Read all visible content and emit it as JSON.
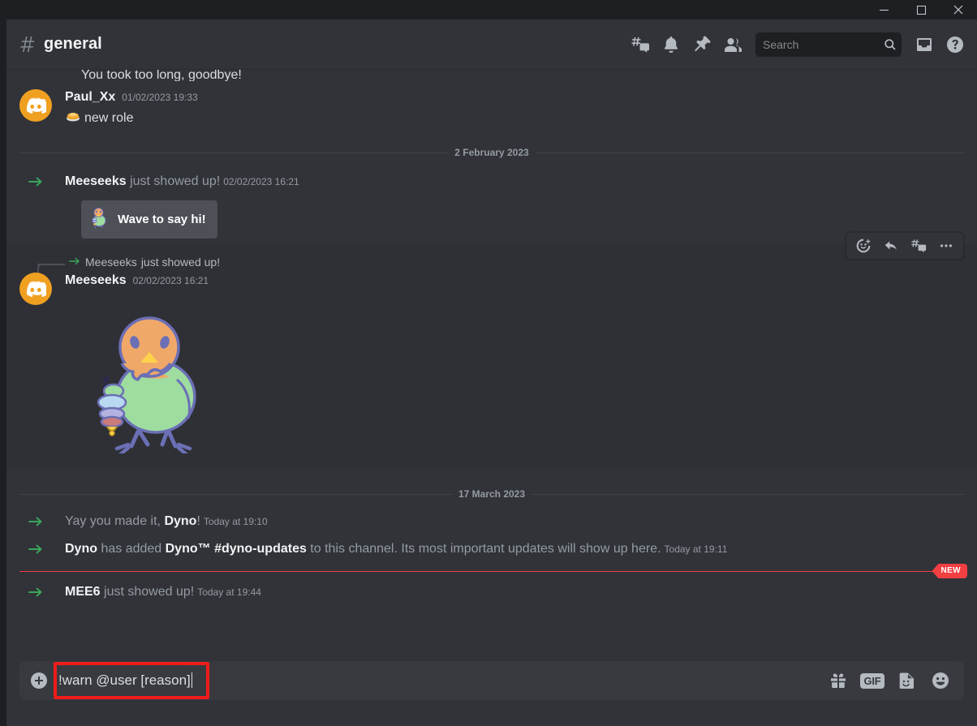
{
  "window": {
    "minimize_label": "Minimize",
    "maximize_label": "Maximize",
    "close_label": "Close"
  },
  "header": {
    "hash_icon": "hash-icon",
    "channel_name": "general",
    "icons": [
      {
        "name": "threads-icon",
        "label": "Threads"
      },
      {
        "name": "bell-icon",
        "label": "Notification Settings"
      },
      {
        "name": "pin-icon",
        "label": "Pinned Messages"
      },
      {
        "name": "members-icon",
        "label": "Member List"
      }
    ],
    "search": {
      "placeholder": "Search",
      "icon": "search-icon"
    },
    "right_icons": [
      {
        "name": "inbox-icon",
        "label": "Inbox"
      },
      {
        "name": "help-icon",
        "label": "Help"
      }
    ]
  },
  "chat": {
    "clipped_message": "You took too long, goodbye!",
    "messages": [
      {
        "type": "user",
        "author": "Paul_Xx",
        "timestamp": "01/02/2023 19:33",
        "emoji": "role-stack-emoji",
        "content": "new role"
      }
    ],
    "divider_1": "2 February 2023",
    "join_message": {
      "author": "Meeseeks",
      "text": " just showed up!",
      "timestamp": "02/02/2023 16:21",
      "wave_button_label": "Wave to say hi!",
      "wave_button_icon": "bird-mascot-icon"
    },
    "reply_message": {
      "reply_to_author": "Meeseeks",
      "reply_to_text": " just showed up!",
      "author": "Meeseeks",
      "timestamp": "02/02/2023 16:21",
      "attachment_alt": "bird-mascot-image"
    },
    "hover_toolbar": [
      {
        "name": "add-reaction-icon",
        "label": "Add Reaction"
      },
      {
        "name": "reply-icon",
        "label": "Reply"
      },
      {
        "name": "create-thread-icon",
        "label": "Create Thread"
      },
      {
        "name": "more-options-icon",
        "label": "More"
      }
    ],
    "divider_2": "17 March 2023",
    "system_messages": [
      {
        "pre": "Yay you made it, ",
        "bold": "Dyno",
        "post": "!",
        "timestamp": "Today at 19:10"
      },
      {
        "pre": "",
        "bold": "Dyno",
        "mid": " has added ",
        "bold2": "Dyno™ #dyno-updates",
        "post": " to this channel. Its most important updates will show up here.",
        "timestamp": "Today at 19:11"
      },
      {
        "pre": "",
        "bold": "MEE6",
        "post": " just showed up!",
        "timestamp": "Today at 19:44"
      }
    ],
    "unread_badge": "NEW"
  },
  "composer": {
    "add_icon": "plus-circle-icon",
    "value": "!warn @user [reason]",
    "icons": [
      {
        "name": "gift-icon",
        "label": "Gift"
      },
      {
        "name": "gif-icon",
        "label": "GIF"
      },
      {
        "name": "sticker-icon",
        "label": "Sticker"
      },
      {
        "name": "emoji-icon",
        "label": "Emoji"
      }
    ]
  },
  "colors": {
    "accent_green": "#3ba55c",
    "unread_red": "#f23f42",
    "highlight_red": "#f01b1b",
    "avatar_orange": "#f0a020",
    "chat_bg": "#313338",
    "titlebar_bg": "#1e1f22"
  }
}
